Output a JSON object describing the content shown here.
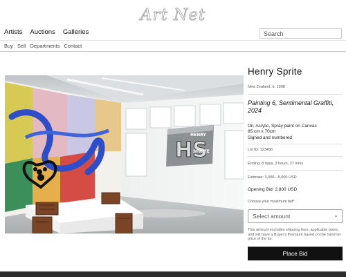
{
  "brand": {
    "logo_text": "Art Net"
  },
  "nav": {
    "items": [
      "Artists",
      "Auctions",
      "Galleries"
    ]
  },
  "search": {
    "placeholder": "Search"
  },
  "subnav": {
    "items": [
      "Buy",
      "Sell",
      "Departments",
      "Contact"
    ]
  },
  "artwork": {
    "logo_text_top": "HENRY",
    "logo_text_bottom": "SPRITE",
    "logo_initials": "HS"
  },
  "lot": {
    "artist": "Henry Sprite",
    "origin": "New Zealand, b. 1998",
    "title": "Painting 6, Sentimental Graffiti, 2024",
    "medium": "Oil, Acrylic, Spray paint on Canvas",
    "dimensions": "85 cm x 70cm",
    "signed": "Signed and numbered",
    "lot_id": "Lot ID: 123456",
    "ending": "Ending: 8 days, 3 hours, 27 mins",
    "estimate": "Estimate: 3,000—5,000 USD",
    "opening_bid": "Opening Bid: 2,800 USD",
    "choose_label": "Choose your maximum bid*",
    "select_placeholder": "Select amount",
    "disclaimer": "This amount excludes shipping fees, applicable taxes, and will have a Buyer's Premium based on the hammer price of the lot",
    "bid_button": "Place Bid"
  }
}
